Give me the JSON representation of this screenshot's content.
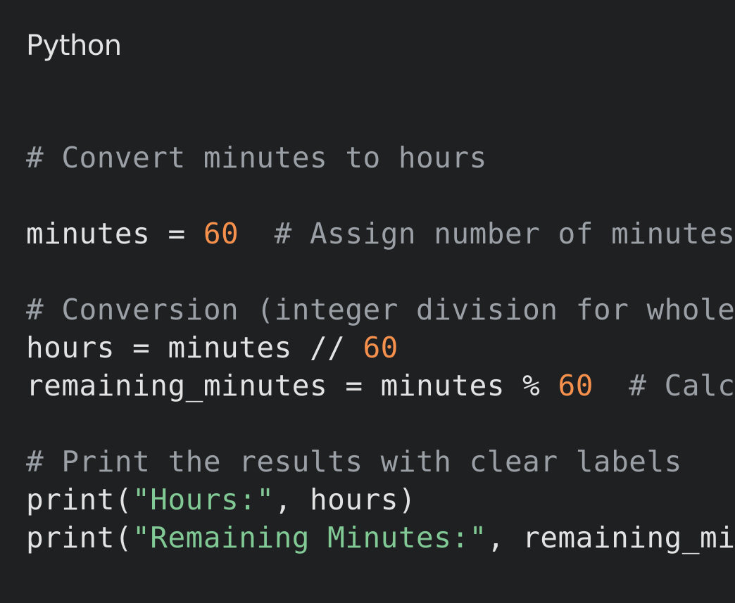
{
  "language_label": "Python",
  "colors": {
    "background": "#1f2022",
    "plain": "#e3e3e3",
    "comment": "#9aa0a6",
    "number": "#f6914d",
    "string": "#81c995"
  },
  "code": {
    "line1": {
      "comment": "# Convert minutes to hours"
    },
    "line2": {
      "a": "minutes = ",
      "num": "60",
      "comment": "  # Assign number of minutes"
    },
    "line3": {
      "comment": "# Conversion (integer division for whole"
    },
    "line4": {
      "a": "hours = minutes // ",
      "num": "60"
    },
    "line5": {
      "a": "remaining_minutes = minutes % ",
      "num": "60",
      "comment": "  # Calc"
    },
    "line6": {
      "comment": "# Print the results with clear labels"
    },
    "line7": {
      "a": "print(",
      "str": "\"Hours:\"",
      "b": ", hours)"
    },
    "line8": {
      "a": "print(",
      "str": "\"Remaining Minutes:\"",
      "b": ", remaining_mi"
    }
  }
}
